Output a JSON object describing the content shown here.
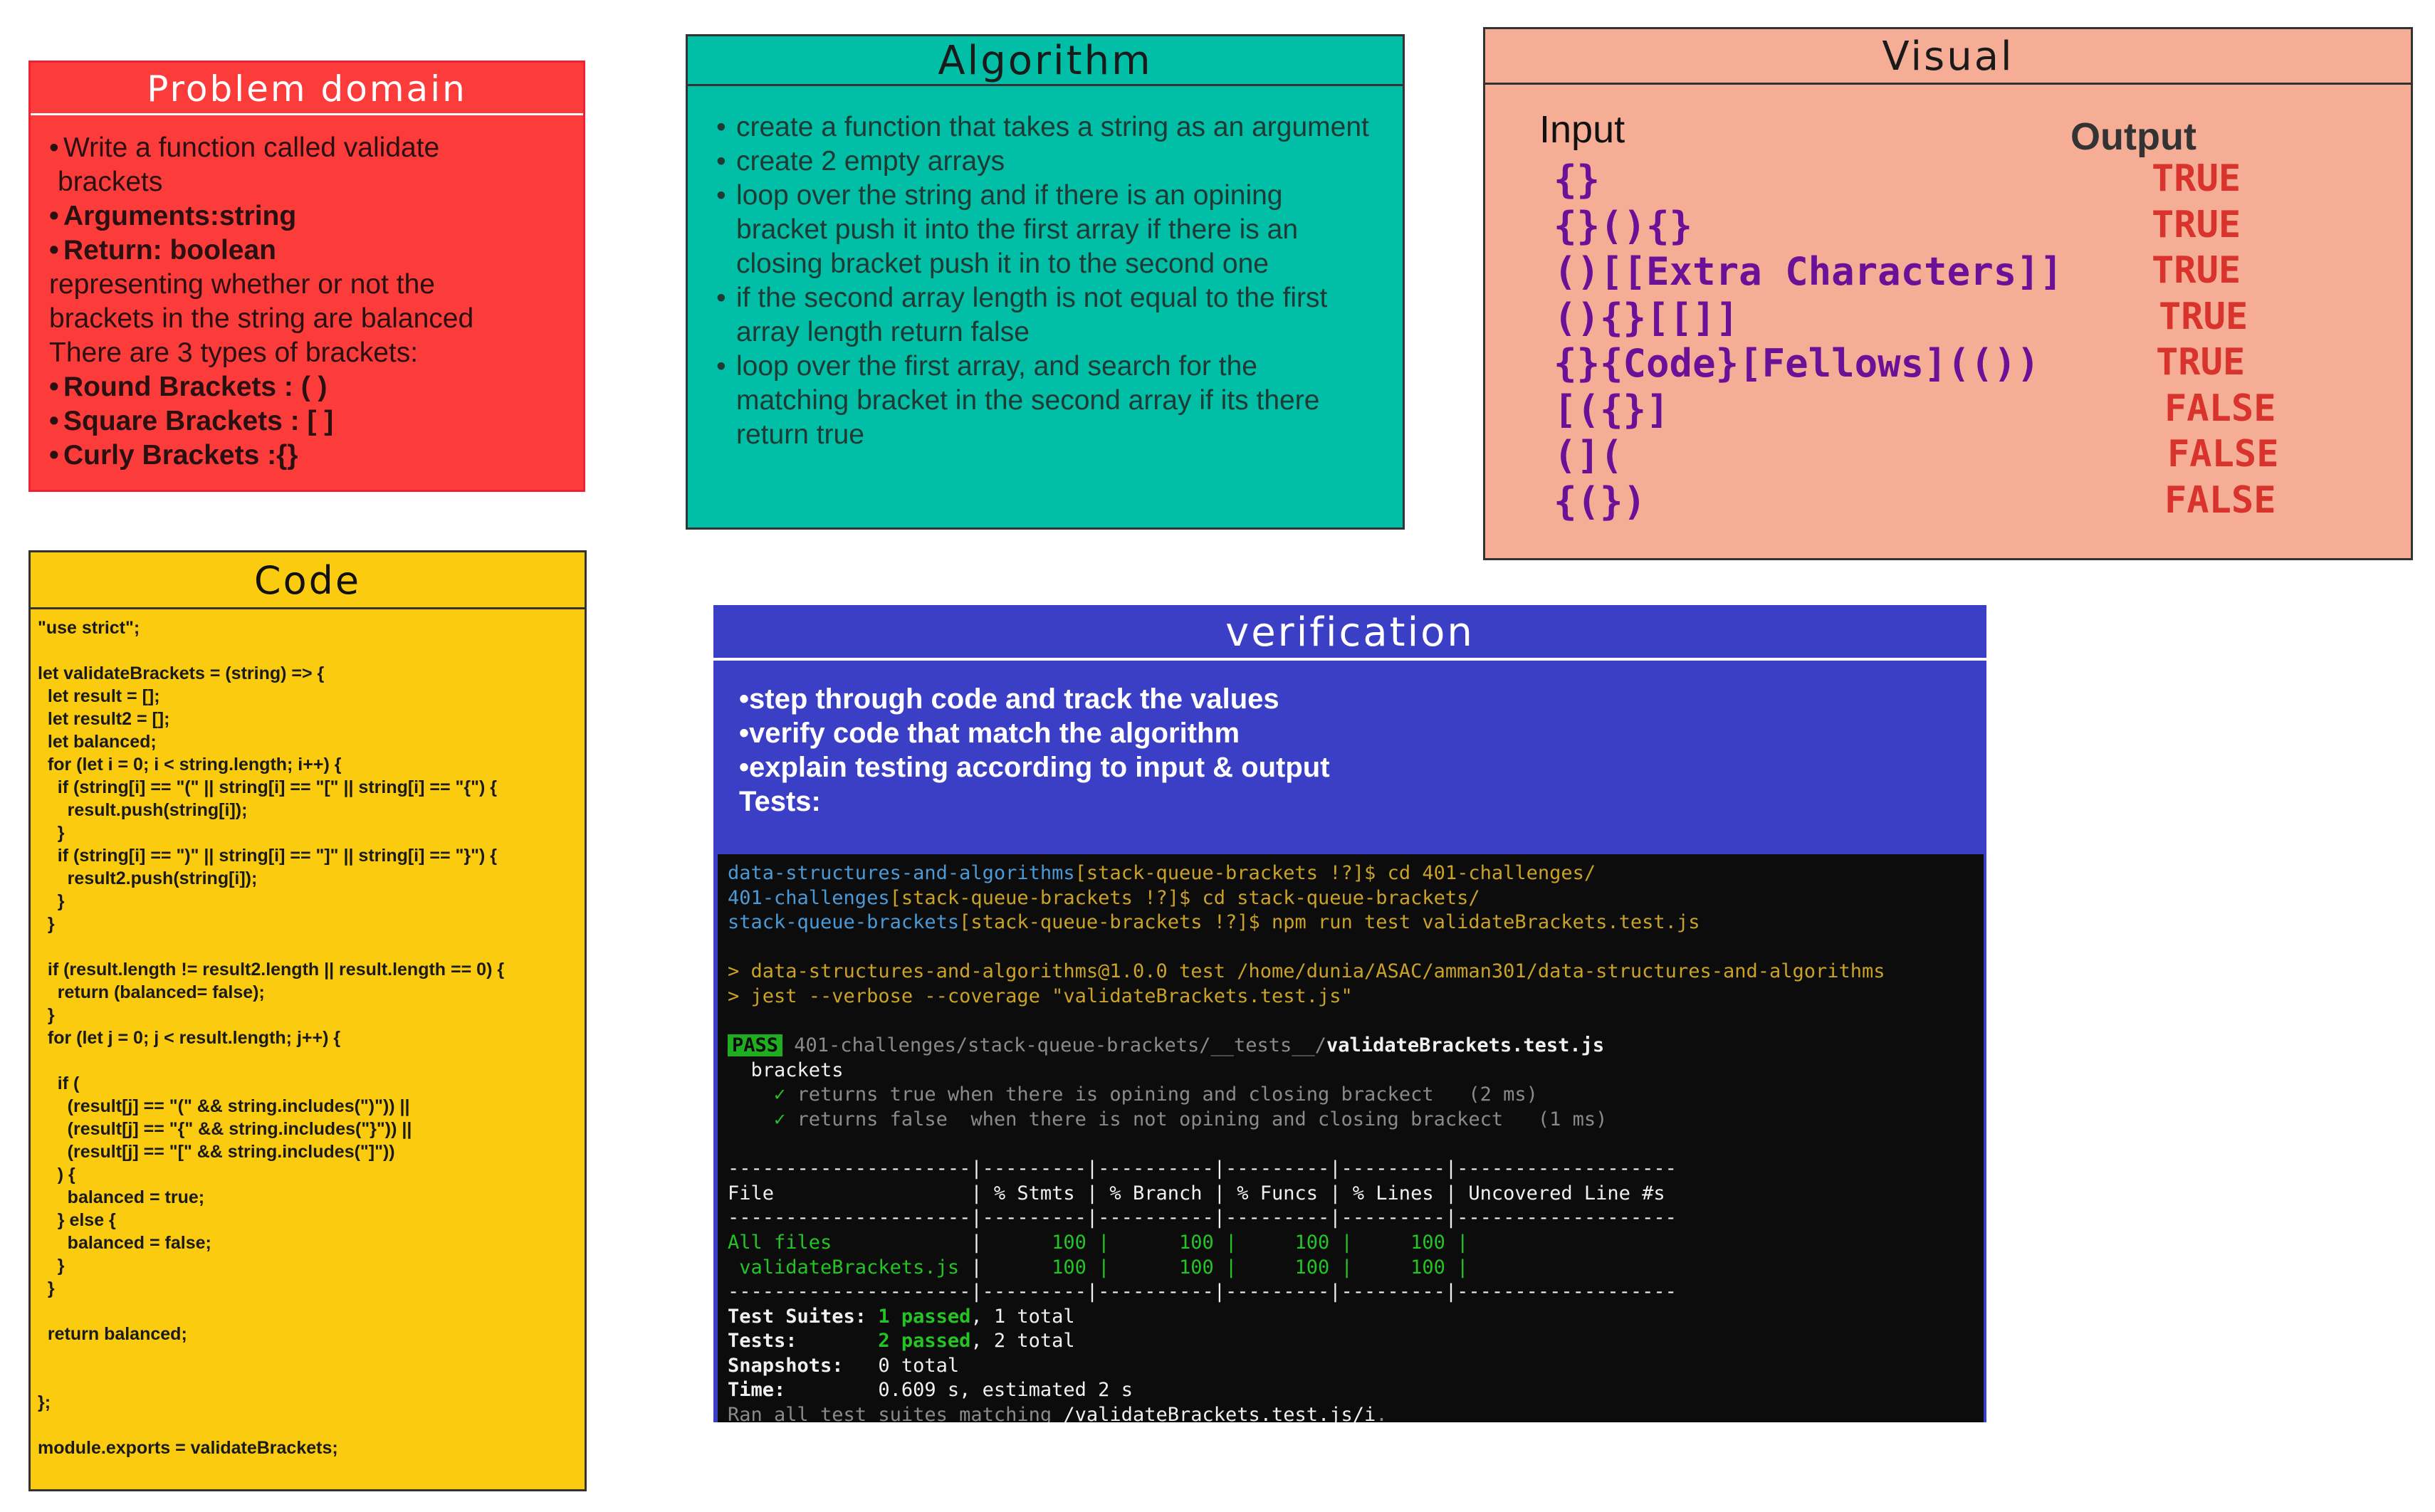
{
  "problem": {
    "title": "Problem domain",
    "bullet1_a": "Write a function called validate",
    "bullet1_b": "brackets",
    "bullet2": "Arguments:string",
    "bullet3": "Return: boolean",
    "line4": "representing whether or not the",
    "line5": "brackets in the string are balanced",
    "line6": "There are 3 types of brackets:",
    "bullet7": "Round Brackets : ( )",
    "bullet8": "Square Brackets : [ ]",
    "bullet9": "Curly Brackets :{}"
  },
  "algorithm": {
    "title": "Algorithm",
    "steps": [
      "create a function that takes a string as an argument",
      "create 2 empty arrays",
      "loop over the string and if there is an opining bracket push it into the first array if there is an closing bracket push it in to the second one",
      "if the second array length is not equal to the first array length return false",
      "loop over the first array, and search for the matching bracket in the second array if its there return true"
    ]
  },
  "visual": {
    "title": "Visual",
    "input_header": "Input",
    "output_header": "Output",
    "rows": [
      {
        "input": "{}",
        "output": "TRUE"
      },
      {
        "input": "{}(){}",
        "output": "TRUE"
      },
      {
        "input": "()[[Extra Characters]]",
        "output": "TRUE"
      },
      {
        "input": "(){}[[]]",
        "output": "TRUE"
      },
      {
        "input": "{}{Code}[Fellows](())",
        "output": "TRUE"
      },
      {
        "input": "[({}]",
        "output": "FALSE"
      },
      {
        "input": "(](",
        "output": "FALSE"
      },
      {
        "input": "{(})",
        "output": "FALSE"
      }
    ]
  },
  "code": {
    "title": "Code",
    "lines": [
      "\"use strict\";",
      "",
      "let validateBrackets = (string) => {",
      "  let result = [];",
      "  let result2 = [];",
      "  let balanced;",
      "  for (let i = 0; i < string.length; i++) {",
      "    if (string[i] == \"(\" || string[i] == \"[\" || string[i] == \"{\") {",
      "      result.push(string[i]);",
      "    }",
      "    if (string[i] == \")\" || string[i] == \"]\" || string[i] == \"}\") {",
      "      result2.push(string[i]);",
      "    }",
      "  }",
      "",
      "  if (result.length != result2.length || result.length == 0) {",
      "    return (balanced= false);",
      "  }",
      "  for (let j = 0; j < result.length; j++) {",
      "",
      "    if (",
      "      (result[j] == \"(\" && string.includes(\")\")) ||",
      "      (result[j] == \"{\" && string.includes(\"}\")) ||",
      "      (result[j] == \"[\" && string.includes(\"]\"))",
      "    ) {",
      "      balanced = true;",
      "    } else {",
      "      balanced = false;",
      "    }",
      "  }",
      "",
      "  return balanced;",
      "",
      "",
      "};",
      "",
      "module.exports = validateBrackets;"
    ]
  },
  "verification": {
    "title": "verification",
    "items": [
      "•step through code and track the values",
      "•verify code that match the algorithm",
      "•explain testing according to input & output",
      "Tests:"
    ],
    "terminal": {
      "l1_path": "data-structures-and-algorithms",
      "l1_rest": "[stack-queue-brackets !?]$ cd 401-challenges/",
      "l2_path": "401-challenges",
      "l2_rest": "[stack-queue-brackets !?]$ cd stack-queue-brackets/",
      "l3_path": "stack-queue-brackets",
      "l3_rest": "[stack-queue-brackets !?]$ npm run test validateBrackets.test.js",
      "l4": "> data-structures-and-algorithms@1.0.0 test /home/dunia/ASAC/amman301/data-structures-and-algorithms",
      "l5": "> jest --verbose --coverage \"validateBrackets.test.js\"",
      "pass_badge": "PASS",
      "pass_path": " 401-challenges/stack-queue-brackets/__tests__/",
      "pass_file": "validateBrackets.test.js",
      "suite": "  brackets",
      "t1_check": "    ✓",
      "t1_text": " returns true when there is opining and closing brackect   (2 ms)",
      "t2_check": "    ✓",
      "t2_text": " returns false  when there is not opining and closing brackect   (1 ms)",
      "sep": "---------------------|---------|----------|---------|---------|-------------------",
      "header": "File                 | % Stmts | % Branch | % Funcs | % Lines | Uncovered Line #s",
      "row1_name": "All files",
      "row1_pad": "            | ",
      "row1_vals": "     100 |      100 |     100 |     100 |",
      "row2_name": " validateBrackets.js",
      "row2_pad": " | ",
      "row2_vals": "     100 |      100 |     100 |     100 |",
      "suites_label": "Test Suites: ",
      "suites_passed": "1 passed",
      "suites_total": ", 1 total",
      "tests_label": "Tests:       ",
      "tests_passed": "2 passed",
      "tests_total": ", 2 total",
      "snap_label": "Snapshots:   ",
      "snap_value": "0 total",
      "time_label": "Time:        ",
      "time_value": "0.609 s, estimated 2 s",
      "ran_prefix": "Ran all test suites matching ",
      "ran_pattern": "/validateBrackets.test.js/i",
      "ran_suffix": "."
    }
  },
  "colors": {
    "problem_bg": "#fc3b3b",
    "algorithm_bg": "#00bfa6",
    "visual_bg": "#f6ad96",
    "code_bg": "#fbcb0f",
    "verification_bg": "#3b3fc6",
    "terminal_bg": "#0c0c0c",
    "true_false_color": "#d8332c",
    "input_color": "#6a1197"
  }
}
